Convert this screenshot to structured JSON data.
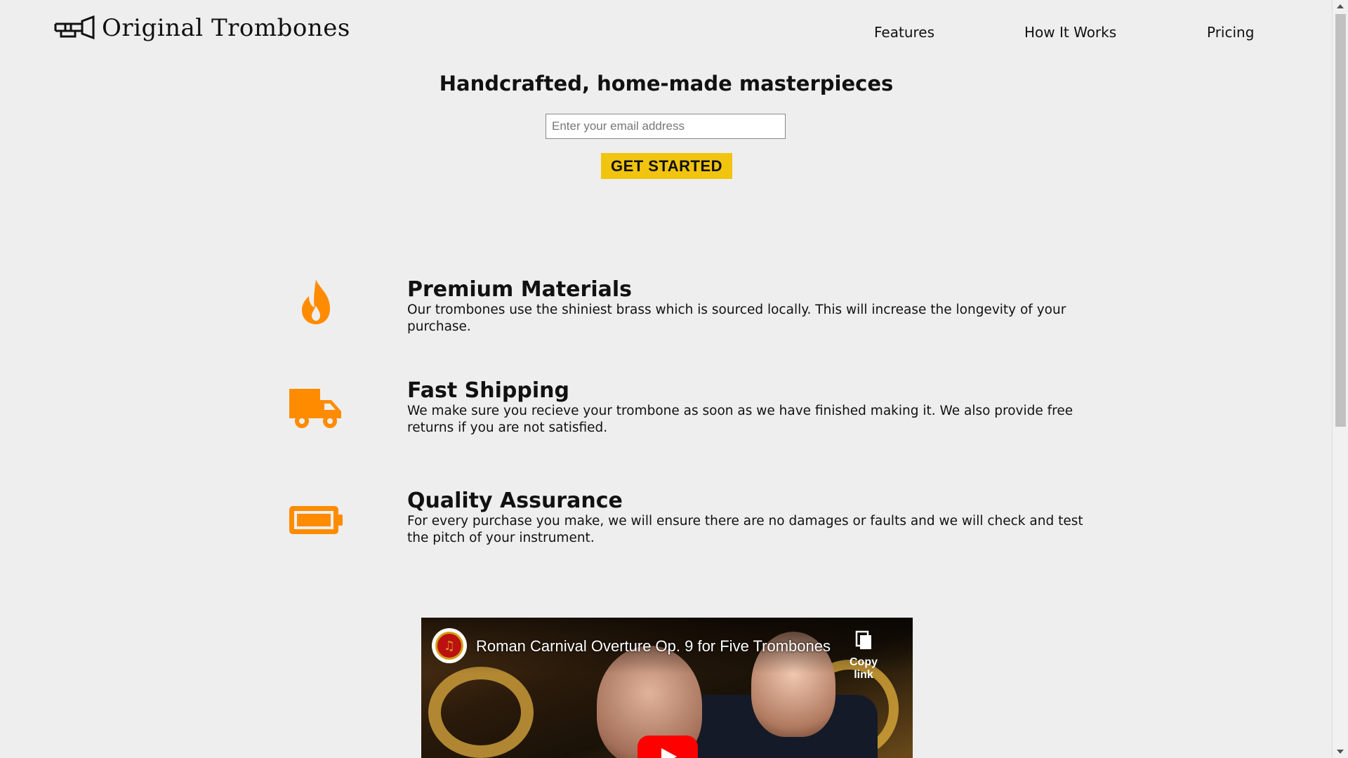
{
  "brand": {
    "name": "Original Trombones",
    "logo_icon": "trombone-icon"
  },
  "nav": {
    "items": [
      "Features",
      "How It Works",
      "Pricing"
    ]
  },
  "hero": {
    "title": "Handcrafted, home-made masterpieces",
    "email_placeholder": "Enter your email address",
    "cta_label": "GET STARTED"
  },
  "features": [
    {
      "icon": "fire-icon",
      "title": "Premium Materials",
      "text": "Our trombones use the shiniest brass which is sourced locally. This will increase the longevity of your purchase."
    },
    {
      "icon": "truck-icon",
      "title": "Fast Shipping",
      "text": "We make sure you recieve your trombone as soon as we have finished making it. We also provide free returns if you are not satisfied."
    },
    {
      "icon": "battery-icon",
      "title": "Quality Assurance",
      "text": "For every purchase you make, we will ensure there are no damages or faults and we will check and test the pitch of your instrument."
    }
  ],
  "video": {
    "title": "Roman Carnival Overture Op. 9 for Five Trombones",
    "copy_label": "Copy link"
  },
  "colors": {
    "accent": "#f1c40f",
    "icon": "#ff8c00",
    "background": "#eeeeee"
  }
}
